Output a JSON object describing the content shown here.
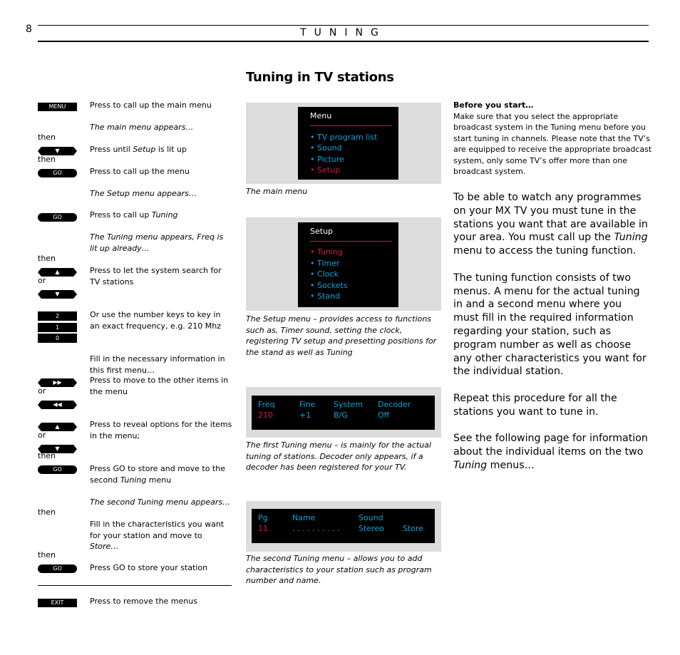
{
  "header": {
    "page_number": "8",
    "section": "TUNING",
    "title": "Tuning in TV stations"
  },
  "steps": {
    "menu_key": "MENU",
    "s1": "Press to call up the main menu",
    "s1_note": "The main menu appears…",
    "then1": "then",
    "down_key": "▼",
    "s2_pre": "Press until ",
    "s2_em": "Setup",
    "s2_post": " is lit up",
    "then2": "then",
    "go_key": "GO",
    "s3": "Press to call up the menu",
    "s3_note": "The Setup menu appears…",
    "s4_pre": "Press to call up ",
    "s4_em": "Tuning",
    "s4_note": "The Tuning menu appears, Freq is lit up already…",
    "then3": "then",
    "up_key": "▲",
    "or1": "or",
    "s5": "Press to let the system search for TV stations",
    "num_keys": [
      "2",
      "1",
      "0"
    ],
    "s6": "Or use the number keys to key in an exact frequency, e.g. 210 Mhz",
    "s7_note": "Fill in the necessary information in this first menu…",
    "ff_key": "▶▶",
    "rw_key": "◀◀",
    "or2": "or",
    "s7": "Press to move to the other items in the menu",
    "or3": "or",
    "s8": "Press to reveal options for the items in the menu;",
    "then4": "then",
    "s9_pre": "Press GO to store and move to the second ",
    "s9_em": "Tuning",
    "s9_post": " menu",
    "s9_note": "The second Tuning menu appears…",
    "then5": "then",
    "s10_pre": "Fill in the characteristics you want for your station and move to ",
    "s10_em": "Store…",
    "then6": "then",
    "s11": "Press GO to store your station",
    "exit_key": "EXIT",
    "s12": "Press to remove the menus"
  },
  "screens": {
    "main_menu": {
      "title": "Menu",
      "items": [
        {
          "label": "• TV program list",
          "active": false
        },
        {
          "label": "• Sound",
          "active": false
        },
        {
          "label": "• Picture",
          "active": false
        },
        {
          "label": "• Setup",
          "active": true
        }
      ],
      "caption": "The main menu"
    },
    "setup_menu": {
      "title": "Setup",
      "items": [
        {
          "label": "• Tuning",
          "active": true
        },
        {
          "label": "• Timer",
          "active": false
        },
        {
          "label": "• Clock",
          "active": false
        },
        {
          "label": "• Sockets",
          "active": false
        },
        {
          "label": "• Stand",
          "active": false
        }
      ],
      "caption": "The Setup menu – provides access to functions such as, Timer sound, setting the clock, registering TV setup and presetting positions for the stand as well as Tuning"
    },
    "tuning_menu_1": {
      "headers": [
        "Freq",
        "Fine",
        "System",
        "Decoder"
      ],
      "values": [
        "210",
        "+1",
        "B/G",
        "Off"
      ],
      "caption": "The first Tuning menu – is mainly for the actual tuning of stations. Decoder only appears, if a decoder has been registered for your TV."
    },
    "tuning_menu_2": {
      "headers": [
        "Pg",
        "Name",
        "Sound",
        ""
      ],
      "values": [
        "11",
        ". . . . . . . . . .",
        "Stereo",
        "Store"
      ],
      "caption": "The second Tuning menu – allows you to add characteristics to your station such as program number and name."
    }
  },
  "right": {
    "before_title": "Before you start…",
    "before_body": "Make sure that you select the appropriate broadcast system in the Tuning menu before you start tuning in channels. Please note that the TV’s are equipped to receive the appropriate broadcast system, only some TV’s offer more than one broadcast system.",
    "p1_pre": "To be able to watch any programmes on your MX TV you must tune in the stations you want that are available in your area. You must call up the ",
    "p1_em": "Tuning",
    "p1_post": " menu to access the tuning function.",
    "p2": "The tuning function consists of two menus. A menu for the actual tuning in and a second menu where you must fill in the required information regarding your station, such as program number as well as choose any other characteristics you want for the individual station.",
    "p3": "Repeat this procedure for all the stations you want to tune in.",
    "p4_pre": "See the following page for information about the individual items on the two ",
    "p4_em": "Tuning",
    "p4_post": " menus…"
  },
  "colors": {
    "osd_blue": "#0ea1d9",
    "osd_red": "#d1184a",
    "panel_gray": "#dcdcdc"
  }
}
